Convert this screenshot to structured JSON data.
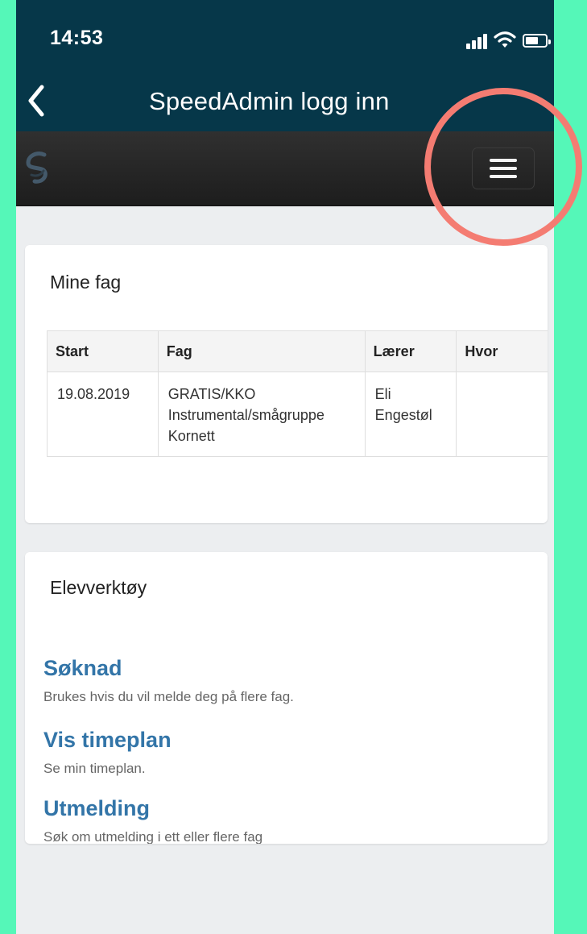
{
  "status_bar": {
    "time": "14:53",
    "icons": [
      "signal-icon",
      "wifi-icon",
      "battery-icon"
    ]
  },
  "nav": {
    "title": "SpeedAdmin logg inn",
    "back_icon": "chevron-left-icon"
  },
  "header": {
    "logo_icon": "speedadmin-logo-icon",
    "menu_icon": "hamburger-menu-icon"
  },
  "mine_fag": {
    "title": "Mine fag",
    "headers": [
      "Start",
      "Fag",
      "Lærer",
      "Hvor"
    ],
    "rows": [
      {
        "start": "19.08.2019",
        "fag": "GRATIS/KKO\nInstrumental/smågruppe\nKornett",
        "laerer": "Eli\nEngestøl",
        "hvor": ""
      }
    ]
  },
  "elevverktoy": {
    "title": "Elevverktøy",
    "items": [
      {
        "label": "Søknad",
        "description": "Brukes hvis du vil melde deg på flere fag."
      },
      {
        "label": "Vis timeplan",
        "description": "Se min timeplan."
      },
      {
        "label": "Utmelding",
        "description": "Søk om utmelding i ett eller flere fag"
      }
    ]
  },
  "colors": {
    "outer_background": "#55f7b8",
    "status_nav_background": "#063749",
    "app_header_background": "#262626",
    "page_background": "#eceef0",
    "link": "#3375a8",
    "highlight_ring": "#f47c72"
  }
}
